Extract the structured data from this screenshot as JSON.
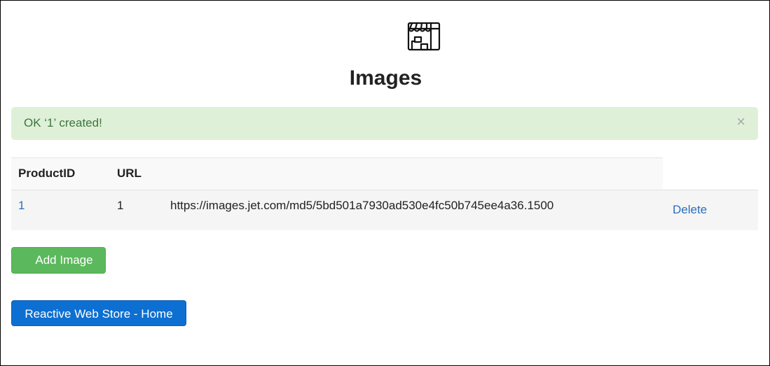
{
  "header": {
    "icon": "store-icon",
    "title": "Images"
  },
  "alert": {
    "message": "OK ‘1’ created!",
    "close_label": "×",
    "color": "#dff0d8"
  },
  "table": {
    "headers": [
      "ProductID",
      "URL"
    ],
    "rows": [
      {
        "product_id": "1",
        "id": "1",
        "url": "https://images.jet.com/md5/5bd501a7930ad530e4fc50b745ee4a36.1500",
        "action_label": "Delete"
      }
    ]
  },
  "buttons": {
    "add_image": "Add Image",
    "home": "Reactive Web Store - Home"
  },
  "colors": {
    "success": "#5cb85c",
    "primary": "#0d6fd1",
    "link": "#2a6ebb"
  }
}
